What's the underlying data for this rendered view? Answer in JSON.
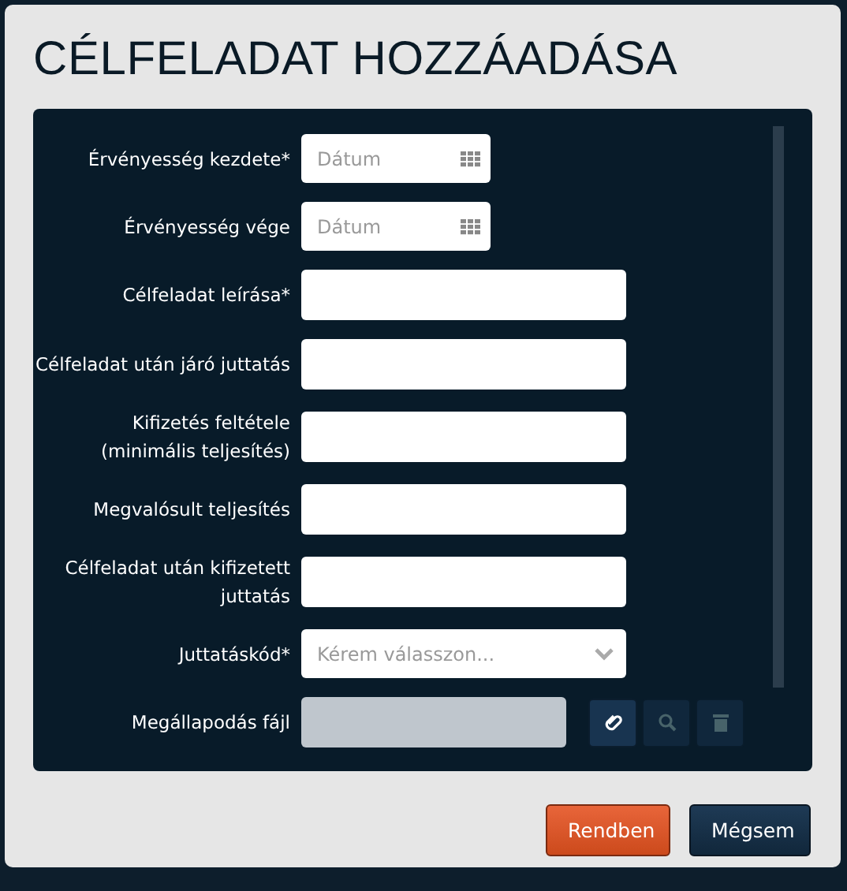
{
  "dialog": {
    "title": "CÉLFELADAT HOZZÁADÁSA"
  },
  "fields": [
    {
      "kind": "date",
      "label": "Érvényesség kezdete*",
      "placeholder": "Dátum"
    },
    {
      "kind": "date",
      "label": "Érvényesség vége",
      "placeholder": "Dátum"
    },
    {
      "kind": "text",
      "label": "Célfeladat leírása*"
    },
    {
      "kind": "text",
      "label": "Célfeladat után járó juttatás"
    },
    {
      "kind": "text",
      "label": "Kifizetés feltétele (minimális teljesítés)"
    },
    {
      "kind": "text",
      "label": "Megvalósult teljesítés"
    },
    {
      "kind": "text",
      "label": "Célfeladat után kifizetett juttatás"
    },
    {
      "kind": "select",
      "label": "Juttatáskód*",
      "placeholder": "Kérem válasszon..."
    },
    {
      "kind": "file",
      "label": "Megállapodás fájl",
      "actions": [
        {
          "kind": "attach",
          "disabled": false
        },
        {
          "kind": "search",
          "disabled": true
        },
        {
          "kind": "delete",
          "disabled": true
        }
      ]
    }
  ],
  "buttons": [
    {
      "kind": "primary",
      "label": "Rendben"
    },
    {
      "kind": "secondary",
      "label": "Mégsem"
    }
  ]
}
